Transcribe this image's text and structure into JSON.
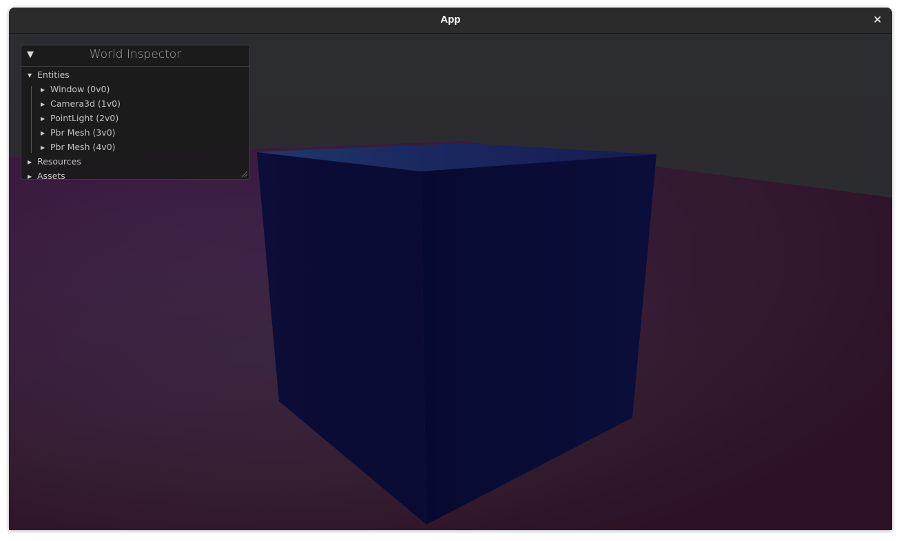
{
  "window": {
    "title": "App",
    "close_glyph": "✕"
  },
  "inspector": {
    "title": "World Inspector",
    "collapse_glyph": "▼",
    "tree": {
      "entities_label": "Entities",
      "entities": [
        {
          "label": "Window (0v0)"
        },
        {
          "label": "Camera3d (1v0)"
        },
        {
          "label": "PointLight (2v0)"
        },
        {
          "label": "Pbr Mesh (3v0)"
        },
        {
          "label": "Pbr Mesh (4v0)"
        }
      ],
      "resources_label": "Resources",
      "assets_label": "Assets"
    },
    "expanded_arrow": "▼",
    "collapsed_arrow": "▶"
  },
  "scene": {
    "background_color": "#2c2d30",
    "plane_colors": [
      "#3a1c45",
      "#341b2e",
      "#2e1428"
    ],
    "cube_colors": [
      "#0b0c36",
      "#080a30",
      "#1c2760"
    ]
  }
}
